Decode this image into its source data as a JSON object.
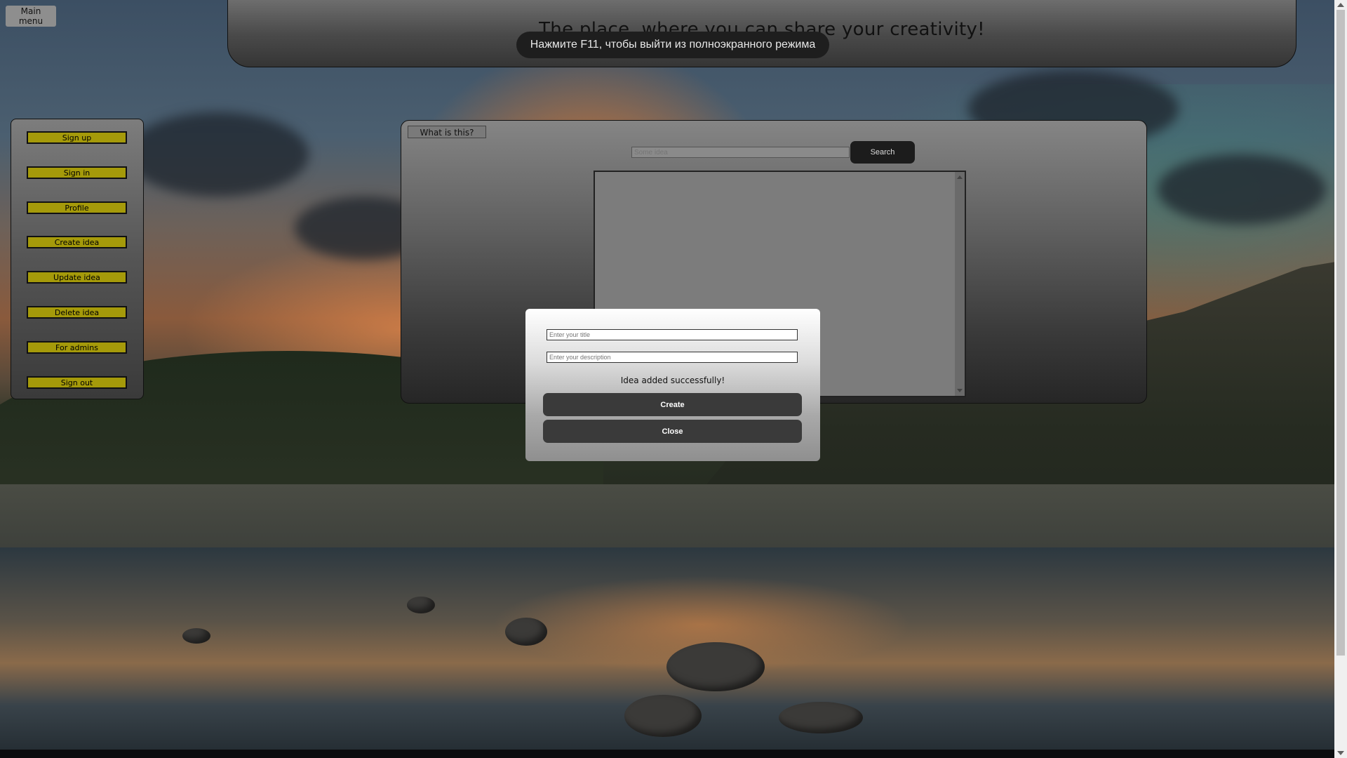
{
  "top": {
    "main_menu_label": "Main menu"
  },
  "header": {
    "title": "The place, where you can share your creativity!"
  },
  "fullscreen_toast": {
    "text": "Нажмите F11, чтобы выйти из полноэкранного режима"
  },
  "sidebar": {
    "items": [
      {
        "label": "Sign up"
      },
      {
        "label": "Sign in"
      },
      {
        "label": "Profile"
      },
      {
        "label": "Create idea"
      },
      {
        "label": "Update idea"
      },
      {
        "label": "Delete idea"
      },
      {
        "label": "For admins"
      },
      {
        "label": "Sign out"
      }
    ]
  },
  "panel": {
    "what_label": "What is this?",
    "search": {
      "placeholder": "Some idea",
      "value": "",
      "button_label": "Search"
    }
  },
  "modal": {
    "title_placeholder": "Enter your title",
    "description_placeholder": "Enter your description",
    "message": "Idea added successfully!",
    "create_label": "Create",
    "close_label": "Close"
  },
  "colors": {
    "sidebar_button": "#a59a0a",
    "modal_button": "#3a3a3a",
    "search_button": "#1c1c1c"
  }
}
